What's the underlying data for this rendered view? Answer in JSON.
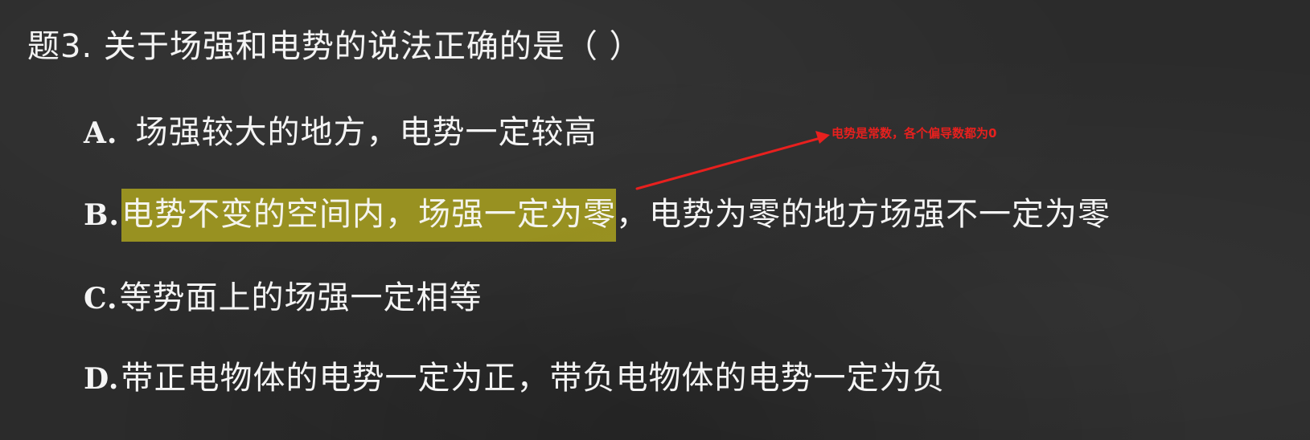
{
  "question": {
    "title": "题3. 关于场强和电势的说法正确的是（  ）"
  },
  "options": {
    "a": {
      "letter": "A.",
      "text": "场强较大的地方，电势一定较高"
    },
    "b": {
      "letter": "B.",
      "highlighted_text": "电势不变的空间内，场强一定为零",
      "rest_text": "，电势为零的地方场强不一定为零"
    },
    "c": {
      "letter": "C.",
      "text": "等势面上的场强一定相等"
    },
    "d": {
      "letter": "D.",
      "text": "带正电物体的电势一定为正，带负电物体的电势一定为负"
    }
  },
  "annotation": {
    "text": "电势是常数，各个偏导数都为0",
    "color": "#e8201e"
  },
  "colors": {
    "background": "#2b2b2b",
    "highlight": "#aaa21e",
    "text": "#f4f4f4"
  }
}
